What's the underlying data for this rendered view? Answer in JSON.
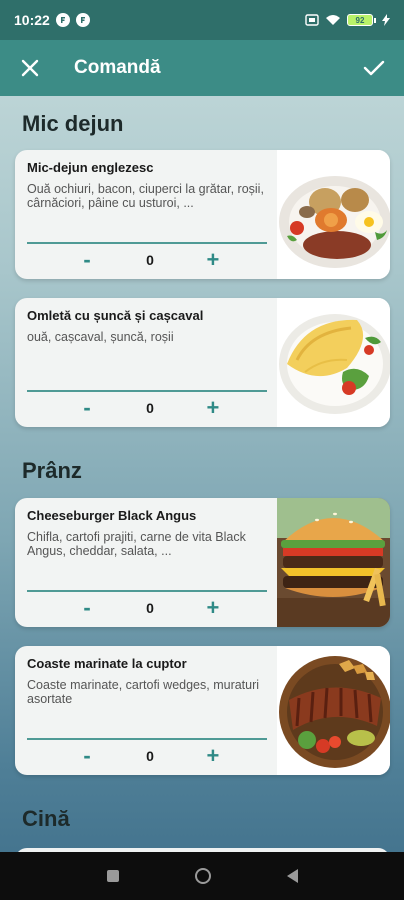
{
  "status_bar": {
    "time": "10:22",
    "battery": "92"
  },
  "app_bar": {
    "title": "Comandă"
  },
  "sections": [
    {
      "title": "Mic dejun",
      "items": [
        {
          "name": "Mic-dejun englezesc",
          "desc": "Ouă ochiuri, bacon, ciuperci la grătar, roșii, cârnăciori, pâine cu usturoi, ...",
          "qty": "0"
        },
        {
          "name": "Omletă cu șuncă și cașcaval",
          "desc": "ouă, cașcaval, șuncă, roșii",
          "qty": "0"
        }
      ]
    },
    {
      "title": "Prânz",
      "items": [
        {
          "name": "Cheeseburger Black Angus",
          "desc": "Chifla, cartofi prajiti, carne de vita Black Angus, cheddar, salata, ...",
          "qty": "0"
        },
        {
          "name": "Coaste marinate la cuptor",
          "desc": "Coaste marinate, cartofi wedges, muraturi asortate",
          "qty": "0"
        }
      ]
    },
    {
      "title": "Cină",
      "items": []
    }
  ],
  "stepper": {
    "minus": "-",
    "plus": "+"
  },
  "colors": {
    "status_bar": "#2f6f6a",
    "app_bar": "#3c8c86",
    "accent": "#2f8a86"
  }
}
